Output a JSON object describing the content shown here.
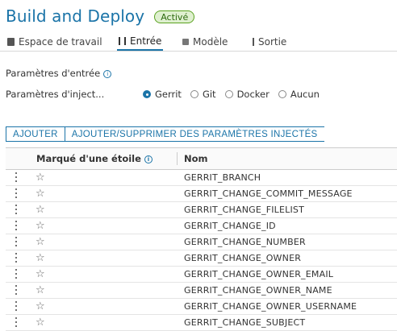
{
  "header": {
    "title": "Build and Deploy",
    "status_badge": "Activé"
  },
  "tabs": [
    {
      "label": "Espace de travail",
      "icon": "workspace-icon",
      "active": false
    },
    {
      "label": "Entrée",
      "icon": "input-icon",
      "active": true
    },
    {
      "label": "Modèle",
      "icon": "model-icon",
      "active": false
    },
    {
      "label": "Sortie",
      "icon": "output-icon",
      "active": false
    }
  ],
  "input_params": {
    "label": "Paramètres d'entrée",
    "info_icon": "info-icon"
  },
  "injection": {
    "label": "Paramètres d'inject...",
    "options": [
      "Gerrit",
      "Git",
      "Docker",
      "Aucun"
    ],
    "selected": "Gerrit"
  },
  "actions": {
    "add_label": "AJOUTER",
    "add_remove_label": "AJOUTER/SUPPRIMER DES PARAMÈTRES INJECTÉS"
  },
  "table": {
    "columns": [
      "Marqué d'une étoile",
      "Nom"
    ],
    "rows": [
      "GERRIT_BRANCH",
      "GERRIT_CHANGE_COMMIT_MESSAGE",
      "GERRIT_CHANGE_FILELIST",
      "GERRIT_CHANGE_ID",
      "GERRIT_CHANGE_NUMBER",
      "GERRIT_CHANGE_OWNER",
      "GERRIT_CHANGE_OWNER_EMAIL",
      "GERRIT_CHANGE_OWNER_NAME",
      "GERRIT_CHANGE_OWNER_USERNAME",
      "GERRIT_CHANGE_SUBJECT"
    ],
    "star_glyph": "☆"
  },
  "colors": {
    "accent": "#1b74a8",
    "badge_border": "#5aa220",
    "badge_bg": "#dff0d0"
  }
}
